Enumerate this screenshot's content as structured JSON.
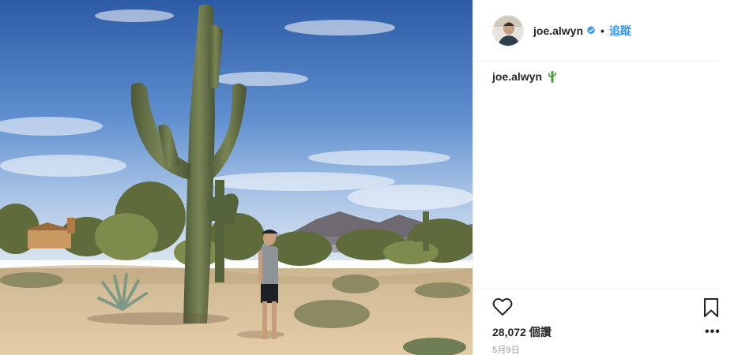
{
  "post": {
    "username": "joe.alwyn",
    "separator": "•",
    "follow_label": "追蹤",
    "caption": {
      "username": "joe.alwyn",
      "emoji": "cactus-emoji"
    },
    "views": "28,072 個讚",
    "date": "5月9日",
    "more_label": "•••"
  },
  "icons": {
    "verified": "verified-badge-icon",
    "like": "heart-icon",
    "save": "bookmark-icon",
    "more": "more-options-icon"
  },
  "colors": {
    "accent": "#3897f0",
    "text": "#262626",
    "muted": "#999999",
    "divider": "#efefef",
    "sky_top": "#2f5fa8",
    "sand": "#d8bf98"
  }
}
